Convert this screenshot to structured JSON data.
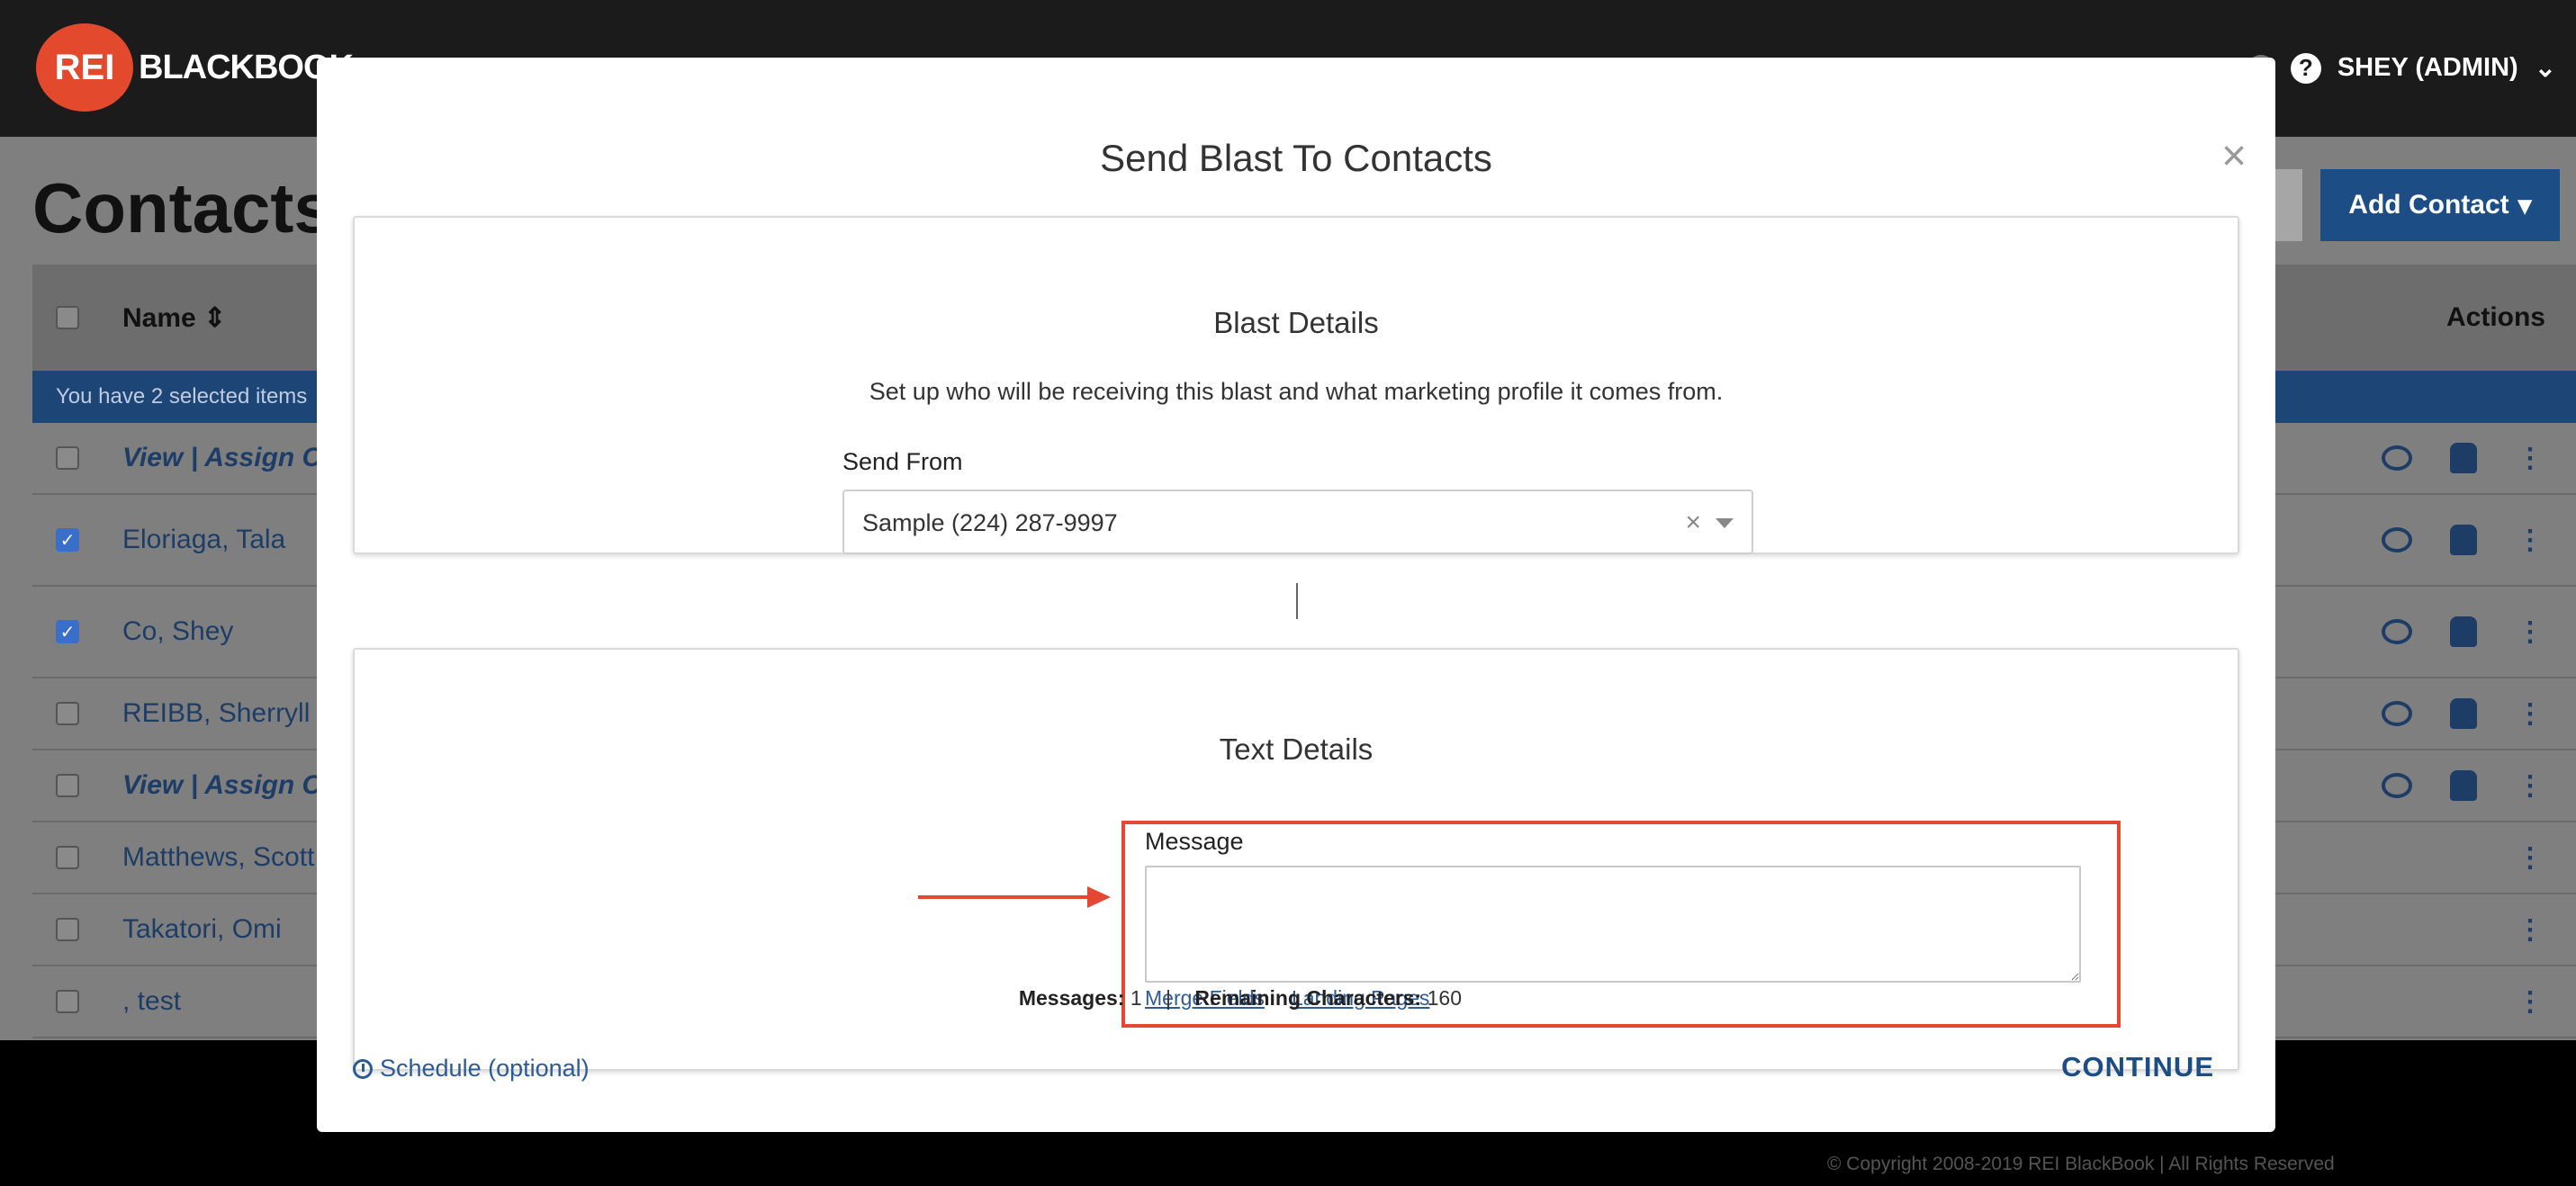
{
  "background": {
    "logo": {
      "badge": "REI",
      "text": "BLACKBOOK"
    },
    "user_menu_label": "SHEY (ADMIN)",
    "page_title": "Contacts",
    "add_contact_label": "Add Contact",
    "table": {
      "col_name": "Name",
      "col_actions": "Actions",
      "selected_notice": "You have 2 selected items",
      "rows": [
        {
          "name": "View | Assign Co",
          "checked": false,
          "style": "italic"
        },
        {
          "name": "Eloriaga, Tala",
          "checked": true
        },
        {
          "name": "Co, Shey",
          "checked": true
        },
        {
          "name": "REIBB, Sherryll",
          "checked": false
        },
        {
          "name": "View | Assign Co",
          "checked": false,
          "style": "italic"
        },
        {
          "name": "Matthews, Scott",
          "checked": false
        },
        {
          "name": "Takatori, Omi",
          "checked": false
        },
        {
          "name": ", test",
          "checked": false
        }
      ]
    },
    "copyright": "© Copyright 2008-2019 REI BlackBook | All Rights Reserved"
  },
  "modal": {
    "title": "Send Blast To Contacts",
    "close_symbol": "×",
    "blast_details": {
      "title": "Blast Details",
      "description": "Set up who will be receiving this blast and what marketing profile it comes from.",
      "send_from_label": "Send From",
      "send_from_value": "Sample (224) 287-9997",
      "clear_symbol": "×"
    },
    "text_details": {
      "title": "Text Details",
      "message_label": "Message",
      "message_value": "",
      "merge_fields_link": "Merge Fields",
      "landing_pages_link": "Landing Pages",
      "messages_label": "Messages:",
      "messages_count": "1",
      "remaining_label": "Remaining Characters:",
      "remaining_count": "160"
    },
    "schedule_label": "Schedule (optional)",
    "continue_label": "CONTINUE"
  },
  "colors": {
    "brand_blue": "#1c4d84",
    "link_blue": "#2d5b96",
    "annotation_red": "#e44734",
    "logo_orange": "#e2492d"
  }
}
